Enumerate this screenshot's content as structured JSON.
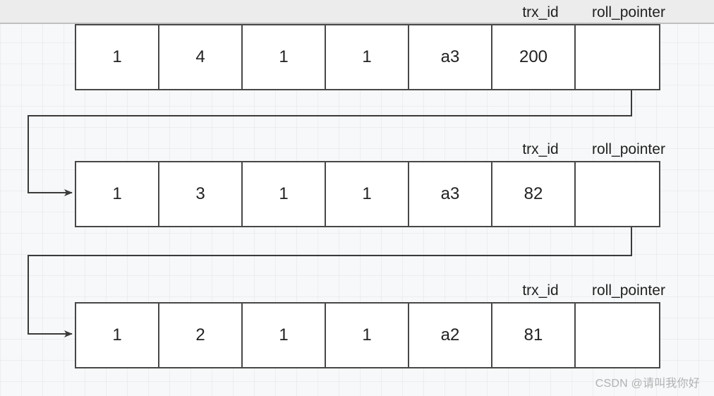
{
  "columnHeaders": {
    "trx_id": "trx_id",
    "roll_pointer": "roll_pointer"
  },
  "rows": [
    {
      "cells": [
        "1",
        "4",
        "1",
        "1",
        "a3",
        "200",
        ""
      ]
    },
    {
      "cells": [
        "1",
        "3",
        "1",
        "1",
        "a3",
        "82",
        ""
      ]
    },
    {
      "cells": [
        "1",
        "2",
        "1",
        "1",
        "a2",
        "81",
        ""
      ]
    }
  ],
  "watermark": "CSDN @请叫我你好"
}
